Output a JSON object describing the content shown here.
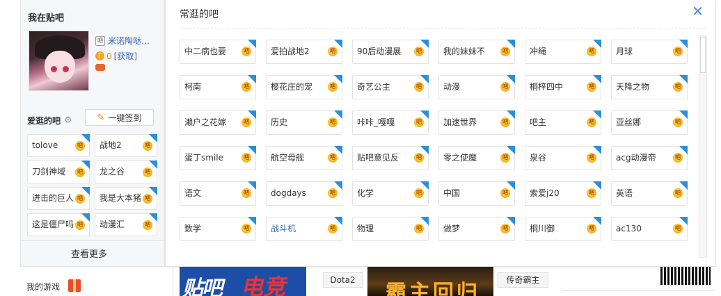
{
  "sidebar": {
    "title": "我在贴吧",
    "username": "米诺陶哒…",
    "coins": "0",
    "get_link": "[获取]",
    "favorites_title": "爱逛的吧",
    "sign_button": "一键签到",
    "favorites": [
      "tolove",
      "战地2",
      "刀剑神域",
      "龙之谷",
      "进击的巨人",
      "我是大本猪",
      "这是僵尸吗",
      "动漫汇"
    ],
    "more": "查看更多"
  },
  "popup": {
    "title": "常逛的吧",
    "forums": [
      "中二病也要",
      "爱拍战地2",
      "90后动漫展",
      "我的妹妹不",
      "冲绳",
      "月球",
      "柯南",
      "樱花庄的宠",
      "奇艺公主",
      "动漫",
      "桐梓四中",
      "天降之物",
      "濑户之花嫁",
      "历史",
      "咔咔_嘎嘎",
      "加速世界",
      "吧主",
      "亚丝娜",
      "蛋丁smile",
      "航空母舰",
      "贴吧意见反",
      "零之使魔",
      "泉谷",
      "acg动漫帝",
      "语文",
      "dogdays",
      "化学",
      "中国",
      "索爱j20",
      "英语",
      "数学",
      "战斗机",
      "物理",
      "做梦",
      "桐川御",
      "ac130"
    ],
    "badge_glyph": "吧"
  },
  "bottom": {
    "games_label": "我的游戏",
    "banner1_a": "贴吧",
    "banner1_b": "电竞",
    "tag_dota2": "Dota2",
    "banner2": "霸主回归",
    "tag_legend": "传奇霸主"
  },
  "colors": {
    "link": "#2d64b3",
    "corner": "#2b8fd8",
    "badge": "#f2a10c"
  },
  "icons": {
    "close": "close-icon",
    "gear": "gear-icon",
    "pencil": "pencil-icon",
    "gift": "gift-icon"
  }
}
